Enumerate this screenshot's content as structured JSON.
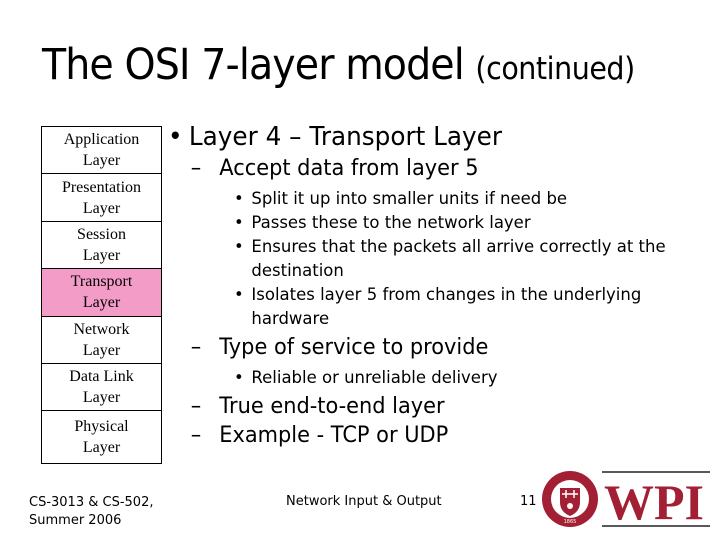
{
  "slide": {
    "title_main": "The OSI 7-layer model",
    "title_sub": "(continued)"
  },
  "layers": [
    {
      "line1": "Application",
      "line2": "Layer",
      "highlighted": false
    },
    {
      "line1": "Presentation",
      "line2": "Layer",
      "highlighted": false
    },
    {
      "line1": "Session",
      "line2": "Layer",
      "highlighted": false
    },
    {
      "line1": "Transport",
      "line2": "Layer",
      "highlighted": true
    },
    {
      "line1": "Network",
      "line2": "Layer",
      "highlighted": false
    },
    {
      "line1": "Data Link",
      "line2": "Layer",
      "highlighted": false
    },
    {
      "line1": "Physical",
      "line2": "Layer",
      "highlighted": false
    }
  ],
  "colors": {
    "highlight": "#f49cc8",
    "wpi_red": "#a31f34"
  },
  "bullets": {
    "heading": "Layer 4 – Transport Layer",
    "items": [
      {
        "text": "Accept data from layer 5",
        "subitems": [
          "Split it up into smaller units if need be",
          "Passes these to the network layer",
          "Ensures that the packets all arrive correctly at the destination",
          "Isolates layer 5 from changes in the underlying hardware"
        ]
      },
      {
        "text": "Type of service to provide",
        "subitems": [
          "Reliable or unreliable delivery"
        ]
      },
      {
        "text": "True end-to-end layer",
        "subitems": []
      },
      {
        "text": "Example - TCP or UDP",
        "subitems": []
      }
    ],
    "dash": "–",
    "dot": "•"
  },
  "footer": {
    "course_line1": "CS-3013 & CS-502,",
    "course_line2": "Summer 2006",
    "topic": "Network Input & Output",
    "page_number": "11",
    "logo_text": "WPI",
    "seal_year": "1865"
  }
}
